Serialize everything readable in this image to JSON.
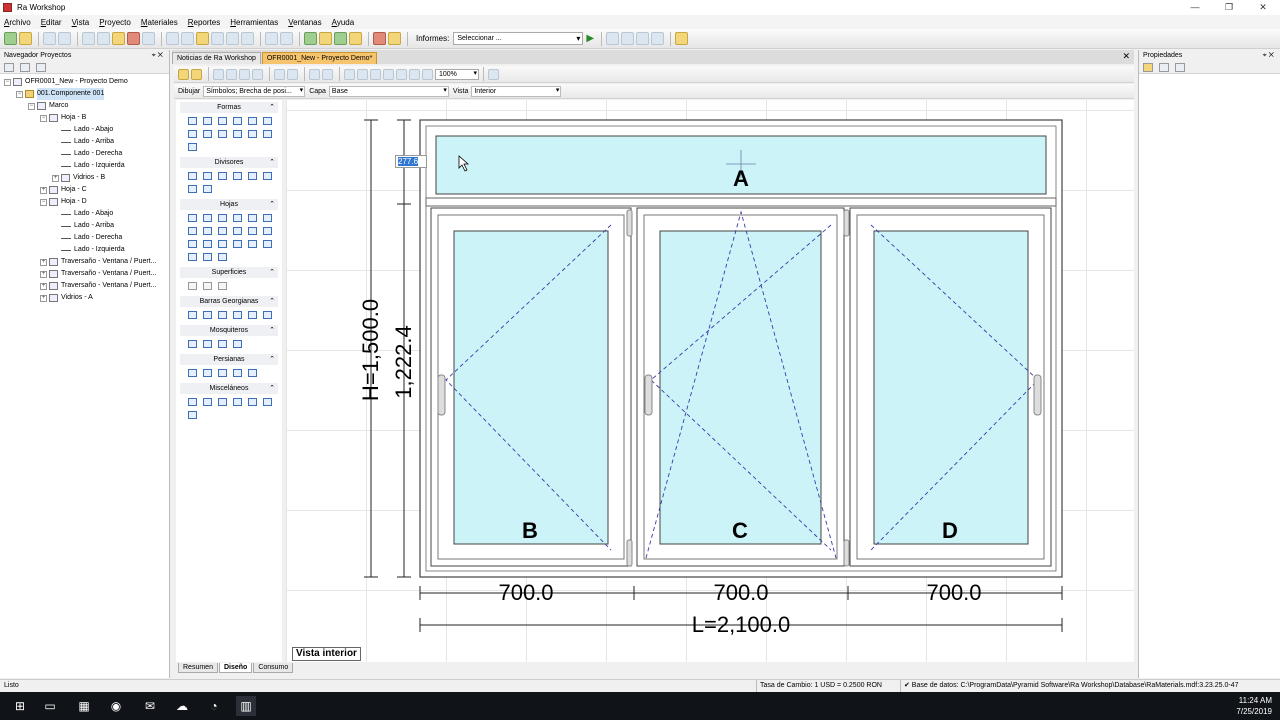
{
  "window": {
    "title": "Ra Workshop",
    "controls": [
      "—",
      "❐",
      "✕"
    ]
  },
  "menu": [
    "Archivo",
    "Editar",
    "Vista",
    "Proyecto",
    "Materiales",
    "Reportes",
    "Herramientas",
    "Ventanas",
    "Ayuda"
  ],
  "toolbar": {
    "reports_label": "Informes:",
    "reports_select": "Seleccionar ..."
  },
  "nav": {
    "title": "Navegador Proyectos",
    "tree": [
      {
        "label": "OFR0001_New - Proyecto Demo",
        "level": 0,
        "exp": "-",
        "icon": "doc"
      },
      {
        "label": "001.Componente 001",
        "level": 1,
        "exp": "-",
        "icon": "folder",
        "selected": true
      },
      {
        "label": "Marco",
        "level": 2,
        "exp": "-",
        "icon": "frame"
      },
      {
        "label": "Hoja - B",
        "level": 3,
        "exp": "-",
        "icon": "sash"
      },
      {
        "label": "Lado - Abajo",
        "level": 4,
        "exp": "",
        "icon": "line"
      },
      {
        "label": "Lado - Arriba",
        "level": 4,
        "exp": "",
        "icon": "line"
      },
      {
        "label": "Lado - Derecha",
        "level": 4,
        "exp": "",
        "icon": "line"
      },
      {
        "label": "Lado - Izquierda",
        "level": 4,
        "exp": "",
        "icon": "line"
      },
      {
        "label": "Vidrios - B",
        "level": 4,
        "exp": "+",
        "icon": "glass"
      },
      {
        "label": "Hoja - C",
        "level": 3,
        "exp": "+",
        "icon": "sash"
      },
      {
        "label": "Hoja - D",
        "level": 3,
        "exp": "-",
        "icon": "sash"
      },
      {
        "label": "Lado - Abajo",
        "level": 4,
        "exp": "",
        "icon": "line"
      },
      {
        "label": "Lado - Arriba",
        "level": 4,
        "exp": "",
        "icon": "line"
      },
      {
        "label": "Lado - Derecha",
        "level": 4,
        "exp": "",
        "icon": "line"
      },
      {
        "label": "Lado - Izquierda",
        "level": 4,
        "exp": "",
        "icon": "line"
      },
      {
        "label": "Traversaño - Ventana / Puert...",
        "level": 3,
        "exp": "+",
        "icon": "mullion"
      },
      {
        "label": "Traversaño - Ventana / Puert...",
        "level": 3,
        "exp": "+",
        "icon": "mullion"
      },
      {
        "label": "Traversaño - Ventana / Puert...",
        "level": 3,
        "exp": "+",
        "icon": "mullion"
      },
      {
        "label": "Vidrios - A",
        "level": 3,
        "exp": "+",
        "icon": "glass"
      }
    ]
  },
  "doc_tabs": [
    "Noticias de Ra Workshop",
    "OFR0001_New - Proyecto Demo*"
  ],
  "draw_toolbar": {
    "zoom": "100%"
  },
  "layer_bar": {
    "draw_label": "Dibujar",
    "symbols_value": "Símbolos; Brecha de posi...",
    "layer_label": "Capa",
    "layer_value": "Base",
    "view_label": "Vista",
    "view_value": "Interior"
  },
  "palette": [
    {
      "title": "Formas",
      "count": 13
    },
    {
      "title": "Divisores",
      "count": 8
    },
    {
      "title": "Hojas",
      "count": 21
    },
    {
      "title": "Superficies",
      "count": 3
    },
    {
      "title": "Barras Georgianas",
      "count": 6
    },
    {
      "title": "Mosquiteros",
      "count": 4
    },
    {
      "title": "Persianas",
      "count": 5
    },
    {
      "title": "Misceláneos",
      "count": 7
    }
  ],
  "drawing": {
    "edit_value": "277.6",
    "panels": [
      "A",
      "B",
      "C",
      "D"
    ],
    "height_total": "H=1,500.0",
    "height_partial": "1,222.4",
    "widths": [
      "700.0",
      "700.0",
      "700.0"
    ],
    "length_total": "L=2,100.0",
    "view_label": "Vista interior"
  },
  "bottom_tabs": [
    "Resumen",
    "Diseño",
    "Consumo"
  ],
  "props": {
    "title": "Propiedades"
  },
  "status": {
    "left": "Listo",
    "rate": "Tasa de Cambio: 1 USD = 0.2500 RON",
    "db": "✔ Base de datos: C:\\ProgramData\\Pyramid Software\\Ra Workshop\\Database\\RaMaterials.mdf:3.23.25.0-47"
  },
  "clock": {
    "time": "11:24 AM",
    "date": "7/25/2019"
  },
  "colors": {
    "glass": "#ccf4f8",
    "accent": "#f7c46e",
    "dash": "#3a3aaa"
  }
}
